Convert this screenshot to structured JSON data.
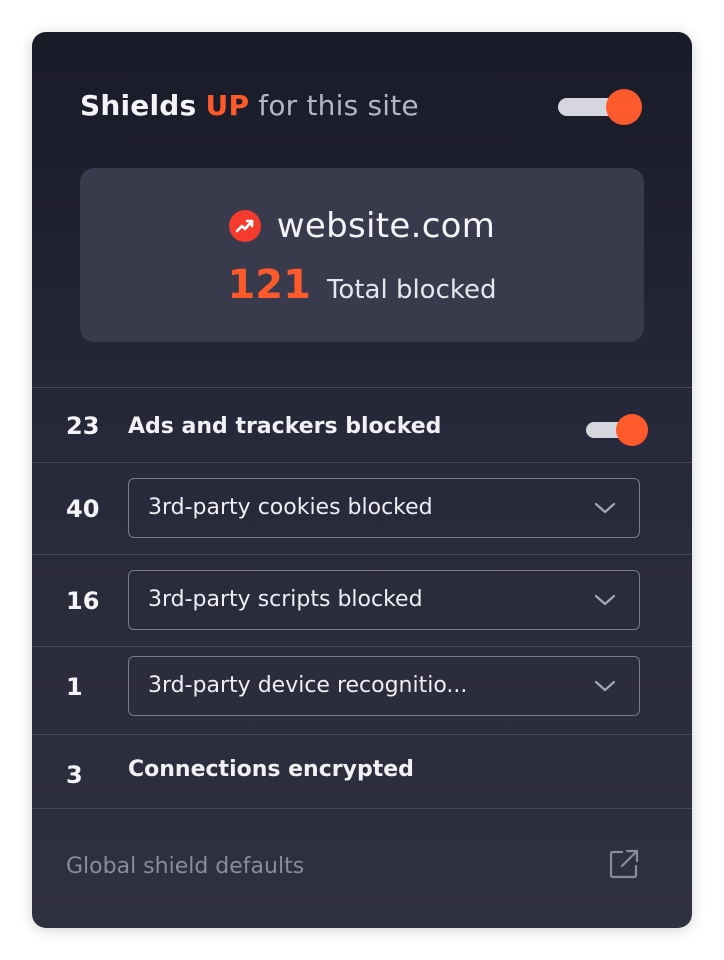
{
  "header": {
    "title_shields": "Shields",
    "title_status": "UP",
    "title_rest": "for this site",
    "toggle_on": true
  },
  "site": {
    "icon": "brand-trend-icon",
    "name": "website.com",
    "total_count": "121",
    "total_label": "Total blocked"
  },
  "rows": [
    {
      "count": "23",
      "label": "Ads and trackers blocked",
      "control": "toggle",
      "toggle_on": true
    },
    {
      "count": "40",
      "label": "3rd-party cookies blocked",
      "control": "dropdown"
    },
    {
      "count": "16",
      "label": "3rd-party scripts blocked",
      "control": "dropdown"
    },
    {
      "count": "1",
      "label": "3rd-party device recognitio...",
      "control": "dropdown"
    },
    {
      "count": "3",
      "label": "Connections encrypted",
      "control": "none"
    }
  ],
  "footer": {
    "label": "Global shield defaults",
    "icon": "external-link-icon"
  },
  "colors": {
    "accent": "#ff5a2b",
    "panel_top": "#1a1b28",
    "panel_bottom": "#30313f",
    "card": "#393a4b",
    "muted_text": "#8a8b9b"
  }
}
